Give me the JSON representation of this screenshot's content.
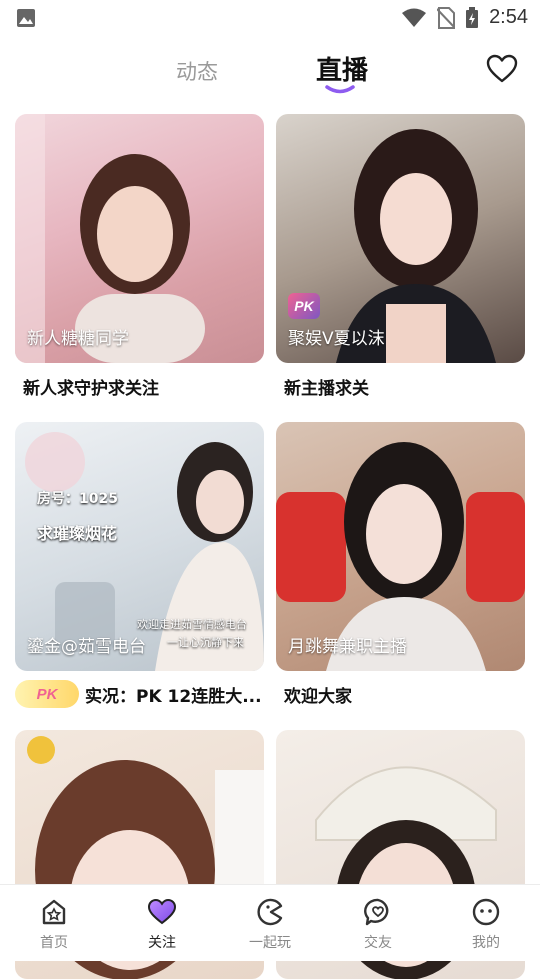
{
  "status_bar": {
    "time": "2:54"
  },
  "top_tabs": {
    "dynamic": "动态",
    "live": "直播"
  },
  "cards": [
    {
      "streamer": "新人糖糖同学",
      "caption": "新人求守护求关注",
      "pk": false
    },
    {
      "streamer": "聚娱V夏以沫",
      "caption": "新主播求关",
      "pk": true,
      "pk_label": "PK"
    },
    {
      "streamer": "鎏金@茹雪电台",
      "caption": "实况：PK 12连胜大...",
      "pk_pill": "PK",
      "overlay": {
        "room": "房号：1025",
        "slogan": "求璀璨烟花",
        "welcome": "欢迎走进茹雪情感电台",
        "sub": "一让心沉静下来"
      }
    },
    {
      "streamer": "月跳舞兼职主播",
      "caption": "欢迎大家"
    },
    {
      "streamer": "",
      "caption": ""
    },
    {
      "streamer": "",
      "caption": ""
    }
  ],
  "bottom_nav": [
    {
      "label": "首页",
      "icon": "home-icon"
    },
    {
      "label": "关注",
      "icon": "heart-filled-icon",
      "active": true
    },
    {
      "label": "一起玩",
      "icon": "pacman-icon"
    },
    {
      "label": "交友",
      "icon": "chat-heart-icon"
    },
    {
      "label": "我的",
      "icon": "smile-icon"
    }
  ],
  "colors": {
    "accent": "#8e5cf0",
    "text": "#111111",
    "muted": "#9a9a9a"
  }
}
